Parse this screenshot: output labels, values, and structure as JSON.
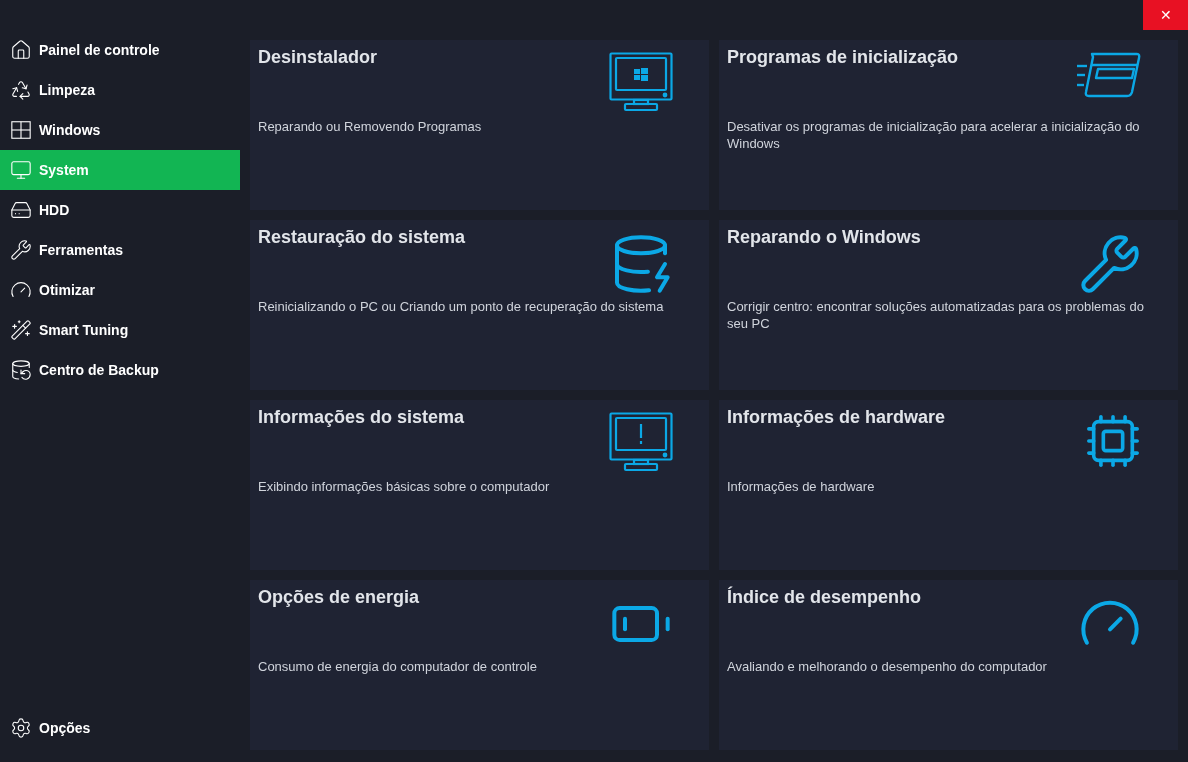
{
  "close_button": "✕",
  "sidebar": {
    "items": [
      {
        "label": "Painel de controle",
        "selected": false
      },
      {
        "label": "Limpeza",
        "selected": false
      },
      {
        "label": "Windows",
        "selected": false
      },
      {
        "label": "System",
        "selected": true
      },
      {
        "label": "HDD",
        "selected": false
      },
      {
        "label": "Ferramentas",
        "selected": false
      },
      {
        "label": "Otimizar",
        "selected": false
      },
      {
        "label": "Smart Tuning",
        "selected": false
      },
      {
        "label": "Centro de Backup",
        "selected": false
      }
    ],
    "footer": {
      "label": "Opções"
    }
  },
  "cards": [
    {
      "title": "Desinstalador",
      "description": "Reparando ou Removendo Programas"
    },
    {
      "title": "Programas de inicialização",
      "description": "Desativar os programas de inicialização para acelerar a inicialização do Windows"
    },
    {
      "title": "Restauração do sistema",
      "description": "Reinicializando o PC ou Criando um ponto de recuperação do sistema"
    },
    {
      "title": "Reparando o Windows",
      "description": "Corrigir centro: encontrar soluções automatizadas para os problemas do seu PC"
    },
    {
      "title": "Informações do sistema",
      "description": "Exibindo informações básicas sobre o computador"
    },
    {
      "title": "Informações de hardware",
      "description": "Informações de hardware"
    },
    {
      "title": "Opções de energia",
      "description": "Consumo de energia do computador de controle"
    },
    {
      "title": "Índice de desempenho",
      "description": "Avaliando e melhorando o desempenho do computador"
    }
  ]
}
